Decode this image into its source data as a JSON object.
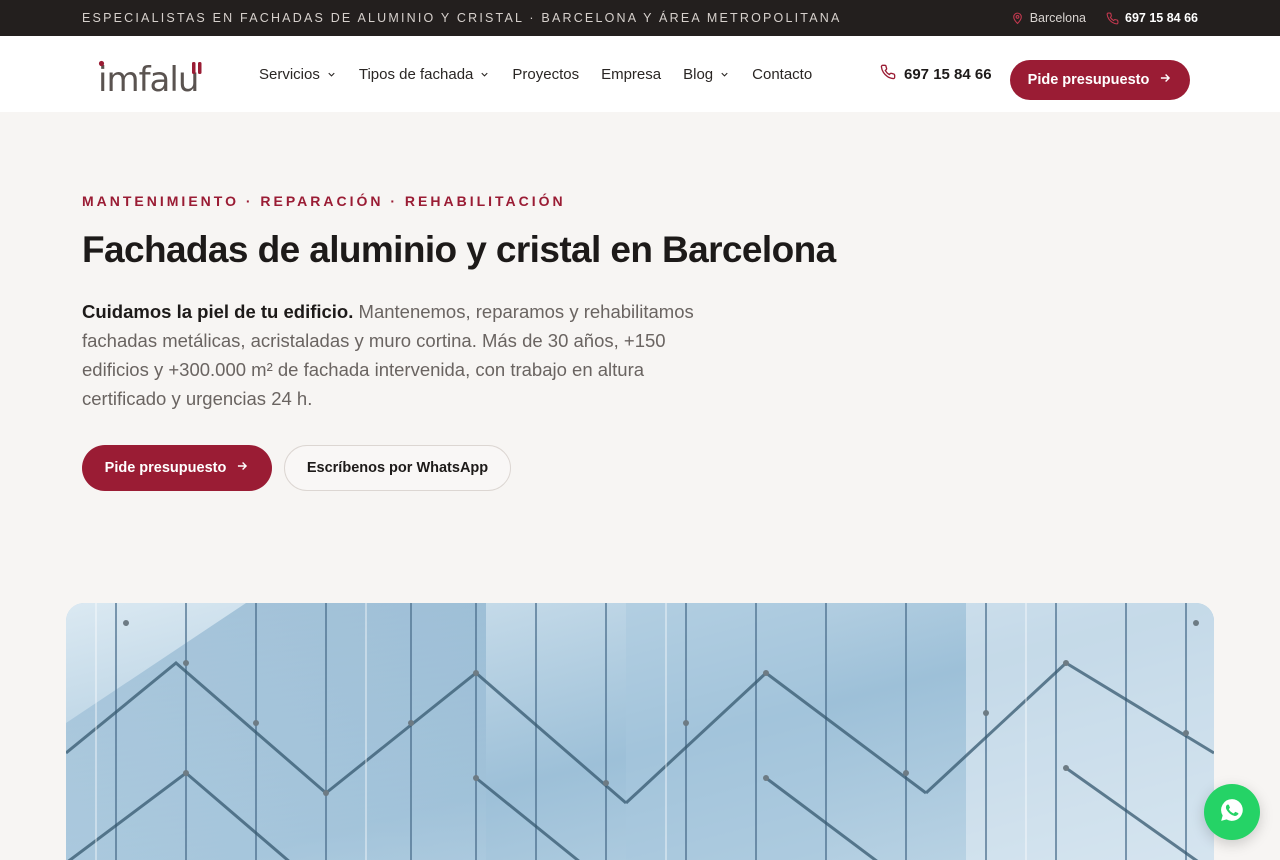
{
  "topbar": {
    "tagline": "ESPECIALISTAS EN FACHADAS DE ALUMINIO Y CRISTAL · BARCELONA Y ÁREA METROPOLITANA",
    "location": "Barcelona",
    "phone": "697 15 84 66"
  },
  "header": {
    "logo_text": "imfalu",
    "nav": [
      {
        "label": "Servicios",
        "has_dropdown": true
      },
      {
        "label": "Tipos de fachada",
        "has_dropdown": true
      },
      {
        "label": "Proyectos",
        "has_dropdown": false
      },
      {
        "label": "Empresa",
        "has_dropdown": false
      },
      {
        "label": "Blog",
        "has_dropdown": true
      },
      {
        "label": "Contacto",
        "has_dropdown": false
      }
    ],
    "phone": "697 15 84 66",
    "cta_label": "Pide presupuesto"
  },
  "hero": {
    "eyebrow": "MANTENIMIENTO · REPARACIÓN · REHABILITACIÓN",
    "title": "Fachadas de aluminio y cristal en Barcelona",
    "lead_strong": "Cuidamos la piel de tu edificio.",
    "lead_text": " Mantenemos, reparamos y rehabilitamos fachadas metálicas, acristaladas y muro cortina. Más de 30 años, +150 edificios y +300.000 m² de fachada intervenida, con trabajo en altura certificado y urgencias 24 h.",
    "cta_primary": "Pide presupuesto",
    "cta_secondary": "Escríbenos por WhatsApp"
  },
  "icons": {
    "location": "map-pin-icon",
    "phone": "phone-icon",
    "chevron": "chevron-down-icon",
    "arrow": "arrow-right-icon",
    "whatsapp": "whatsapp-icon"
  },
  "colors": {
    "brand": "#9a1c34",
    "topbar_bg": "#231f1e",
    "page_bg": "#f7f5f3",
    "whatsapp": "#25d366"
  }
}
